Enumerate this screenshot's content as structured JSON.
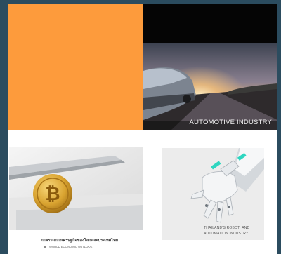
{
  "tiles": {
    "orange": {
      "color": "#fd9b3c"
    },
    "automotive": {
      "caption": "AUTOMOTIVE INDUSTRY"
    },
    "bitcoin": {
      "doc_title": "ภาพรวมการเศรษฐกิจของโลกและประเทศไทย",
      "doc_bullet": "WORLD ECONOMIC OUTLOOK"
    },
    "robot": {
      "caption_line1": "THAILAND'S ROBOT  AND",
      "caption_line2": "AUTOMATION INDUSTRY"
    }
  },
  "colors": {
    "background": "#2b4c5f",
    "orange": "#fd9b3c"
  }
}
